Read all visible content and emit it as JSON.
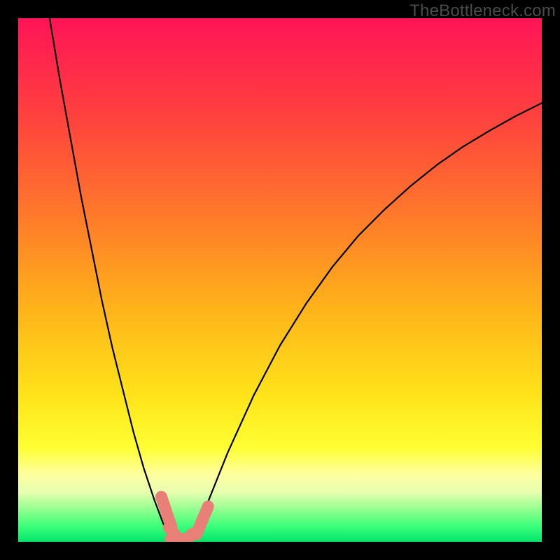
{
  "watermark": "TheBottleneck.com",
  "chart_data": {
    "type": "line",
    "title": "",
    "xlabel": "",
    "ylabel": "",
    "xlim": [
      0,
      100
    ],
    "ylim": [
      0,
      100
    ],
    "grid": false,
    "background_gradient": {
      "stops": [
        {
          "offset": 0.0,
          "color": "#ff1456"
        },
        {
          "offset": 0.18,
          "color": "#ff3f3f"
        },
        {
          "offset": 0.38,
          "color": "#ff7a2a"
        },
        {
          "offset": 0.55,
          "color": "#ffb21a"
        },
        {
          "offset": 0.72,
          "color": "#ffe31a"
        },
        {
          "offset": 0.82,
          "color": "#ffff33"
        },
        {
          "offset": 0.87,
          "color": "#ffff9e"
        },
        {
          "offset": 0.905,
          "color": "#e8ffb0"
        },
        {
          "offset": 0.94,
          "color": "#8eff8e"
        },
        {
          "offset": 0.97,
          "color": "#3cff7a"
        },
        {
          "offset": 1.0,
          "color": "#02e56b"
        }
      ]
    },
    "series": [
      {
        "name": "left-branch",
        "stroke": "#000000",
        "stroke_width": 2.2,
        "points": [
          {
            "x": 6.0,
            "y": 100.0
          },
          {
            "x": 8.0,
            "y": 88.0
          },
          {
            "x": 10.0,
            "y": 77.0
          },
          {
            "x": 12.0,
            "y": 66.0
          },
          {
            "x": 14.0,
            "y": 56.0
          },
          {
            "x": 16.0,
            "y": 46.0
          },
          {
            "x": 18.0,
            "y": 37.0
          },
          {
            "x": 20.0,
            "y": 29.0
          },
          {
            "x": 22.0,
            "y": 21.0
          },
          {
            "x": 24.0,
            "y": 14.0
          },
          {
            "x": 26.0,
            "y": 8.0
          },
          {
            "x": 27.5,
            "y": 4.0
          },
          {
            "x": 28.5,
            "y": 1.5
          },
          {
            "x": 29.5,
            "y": 0.3
          }
        ]
      },
      {
        "name": "right-branch",
        "stroke": "#000000",
        "stroke_width": 2.2,
        "points": [
          {
            "x": 33.0,
            "y": 0.3
          },
          {
            "x": 34.5,
            "y": 3.0
          },
          {
            "x": 36.0,
            "y": 7.0
          },
          {
            "x": 40.0,
            "y": 17.0
          },
          {
            "x": 45.0,
            "y": 28.0
          },
          {
            "x": 50.0,
            "y": 37.5
          },
          {
            "x": 55.0,
            "y": 45.5
          },
          {
            "x": 60.0,
            "y": 52.5
          },
          {
            "x": 65.0,
            "y": 58.5
          },
          {
            "x": 70.0,
            "y": 63.5
          },
          {
            "x": 75.0,
            "y": 68.0
          },
          {
            "x": 80.0,
            "y": 72.0
          },
          {
            "x": 85.0,
            "y": 75.5
          },
          {
            "x": 90.0,
            "y": 78.5
          },
          {
            "x": 95.0,
            "y": 81.3
          },
          {
            "x": 100.0,
            "y": 83.8
          }
        ]
      }
    ],
    "markers": {
      "color": "#e98077",
      "shape": "rounded-segment",
      "points": [
        {
          "x": 27.8,
          "y": 7.2
        },
        {
          "x": 28.8,
          "y": 4.2
        },
        {
          "x": 29.7,
          "y": 1.6
        },
        {
          "x": 30.6,
          "y": 0.5
        },
        {
          "x": 32.2,
          "y": 0.5
        },
        {
          "x": 34.6,
          "y": 2.8
        },
        {
          "x": 35.7,
          "y": 5.4
        }
      ]
    }
  }
}
